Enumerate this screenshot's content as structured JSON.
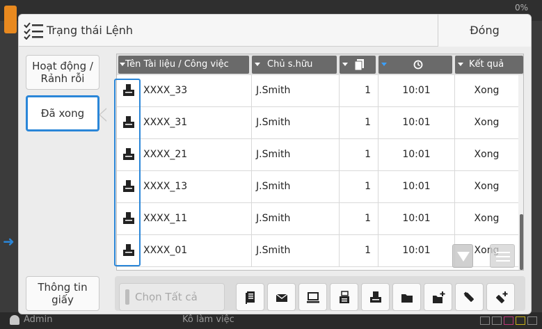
{
  "background": {
    "top_right_text": "0%",
    "user_name": "Admin",
    "mode_text": "Kô làm việc",
    "ink_labels": [
      "K",
      "C",
      "M",
      "Y",
      "G"
    ]
  },
  "header": {
    "title": "Trạng thái Lệnh",
    "close_label": "Đóng"
  },
  "tabs": {
    "active_idle": "Hoạt động / Rảnh rỗi",
    "done": "Đã xong",
    "paper_info": "Thông tin giấy"
  },
  "table": {
    "columns": [
      "Tên Tài liệu / Công việc",
      "Chủ s.hữu",
      "",
      "",
      "Kết quả"
    ],
    "rows": [
      {
        "name": "XXXX_33",
        "owner": "J.Smith",
        "copies": "1",
        "time": "10:01",
        "result": "Xong"
      },
      {
        "name": "XXXX_31",
        "owner": "J.Smith",
        "copies": "1",
        "time": "10:01",
        "result": "Xong"
      },
      {
        "name": "XXXX_21",
        "owner": "J.Smith",
        "copies": "1",
        "time": "10:01",
        "result": "Xong"
      },
      {
        "name": "XXXX_13",
        "owner": "J.Smith",
        "copies": "1",
        "time": "10:01",
        "result": "Xong"
      },
      {
        "name": "XXXX_11",
        "owner": "J.Smith",
        "copies": "1",
        "time": "10:01",
        "result": "Xong"
      },
      {
        "name": "XXXX_01",
        "owner": "J.Smith",
        "copies": "1",
        "time": "10:01",
        "result": "Xong"
      }
    ]
  },
  "toolbar": {
    "select_all_label": "Chọn Tất cả",
    "tools": [
      "copy-icon",
      "mail-icon",
      "computer-icon",
      "fax-icon",
      "print-icon",
      "folder-icon",
      "folder-plus-icon",
      "usb-icon",
      "usb-plus-icon"
    ]
  },
  "colors": {
    "accent": "#2a86d8",
    "header_col": "#6a6a6a"
  }
}
